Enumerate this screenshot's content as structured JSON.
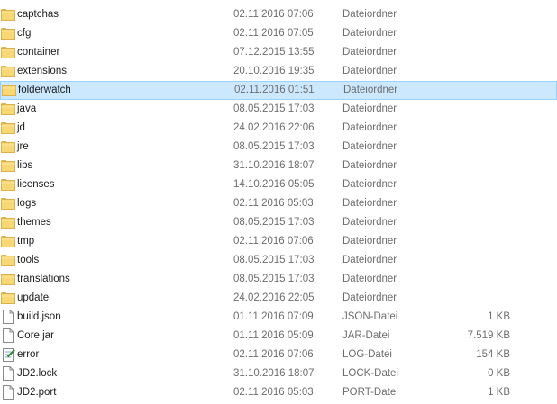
{
  "files": [
    {
      "name": "captchas",
      "date": "02.11.2016 07:06",
      "type": "Dateiordner",
      "size": "",
      "icon": "folder-icon"
    },
    {
      "name": "cfg",
      "date": "02.11.2016 07:05",
      "type": "Dateiordner",
      "size": "",
      "icon": "folder-icon"
    },
    {
      "name": "container",
      "date": "07.12.2015 13:55",
      "type": "Dateiordner",
      "size": "",
      "icon": "folder-icon"
    },
    {
      "name": "extensions",
      "date": "20.10.2016 19:35",
      "type": "Dateiordner",
      "size": "",
      "icon": "folder-icon"
    },
    {
      "name": "folderwatch",
      "date": "02.11.2016 01:51",
      "type": "Dateiordner",
      "size": "",
      "icon": "folder-icon",
      "selected": true
    },
    {
      "name": "java",
      "date": "08.05.2015 17:03",
      "type": "Dateiordner",
      "size": "",
      "icon": "folder-icon"
    },
    {
      "name": "jd",
      "date": "24.02.2016 22:06",
      "type": "Dateiordner",
      "size": "",
      "icon": "folder-icon"
    },
    {
      "name": "jre",
      "date": "08.05.2015 17:03",
      "type": "Dateiordner",
      "size": "",
      "icon": "folder-icon"
    },
    {
      "name": "libs",
      "date": "31.10.2016 18:07",
      "type": "Dateiordner",
      "size": "",
      "icon": "folder-icon"
    },
    {
      "name": "licenses",
      "date": "14.10.2016 05:05",
      "type": "Dateiordner",
      "size": "",
      "icon": "folder-icon"
    },
    {
      "name": "logs",
      "date": "02.11.2016 05:03",
      "type": "Dateiordner",
      "size": "",
      "icon": "folder-icon"
    },
    {
      "name": "themes",
      "date": "08.05.2015 17:03",
      "type": "Dateiordner",
      "size": "",
      "icon": "folder-icon"
    },
    {
      "name": "tmp",
      "date": "02.11.2016 07:06",
      "type": "Dateiordner",
      "size": "",
      "icon": "folder-icon"
    },
    {
      "name": "tools",
      "date": "08.05.2015 17:03",
      "type": "Dateiordner",
      "size": "",
      "icon": "folder-icon"
    },
    {
      "name": "translations",
      "date": "08.05.2015 17:03",
      "type": "Dateiordner",
      "size": "",
      "icon": "folder-icon"
    },
    {
      "name": "update",
      "date": "24.02.2016 22:05",
      "type": "Dateiordner",
      "size": "",
      "icon": "folder-icon"
    },
    {
      "name": "build.json",
      "date": "01.11.2016 07:09",
      "type": "JSON-Datei",
      "size": "1 KB",
      "icon": "file-icon"
    },
    {
      "name": "Core.jar",
      "date": "01.11.2016 05:09",
      "type": "JAR-Datei",
      "size": "7.519 KB",
      "icon": "file-icon"
    },
    {
      "name": "error",
      "date": "02.11.2016 07:06",
      "type": "LOG-Datei",
      "size": "154 KB",
      "icon": "log-file-icon"
    },
    {
      "name": "JD2.lock",
      "date": "31.10.2016 18:07",
      "type": "LOCK-Datei",
      "size": "0 KB",
      "icon": "file-icon"
    },
    {
      "name": "JD2.port",
      "date": "02.11.2016 05:03",
      "type": "PORT-Datei",
      "size": "1 KB",
      "icon": "file-icon"
    }
  ],
  "colors": {
    "folder": "#f8d775",
    "folder_dark": "#dcb04a",
    "selection_bg": "#cce8ff",
    "selection_border": "#99d1ff",
    "meta_text": "#6d6d6d"
  }
}
